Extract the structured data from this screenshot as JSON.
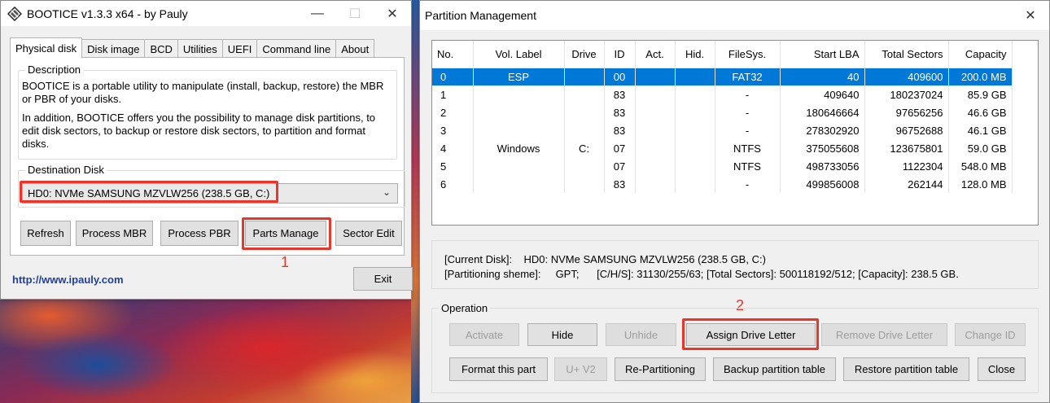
{
  "bootice": {
    "title": "BOOTICE v1.3.3 x64 - by Pauly",
    "tabs": [
      "Physical disk",
      "Disk image",
      "BCD",
      "Utilities",
      "UEFI",
      "Command line",
      "About"
    ],
    "description_legend": "Description",
    "description_p1": "BOOTICE is a portable utility to manipulate (install, backup, restore) the MBR or PBR of your disks.",
    "description_p2": "In addition, BOOTICE offers you the possibility to manage disk partitions, to edit disk sectors, to backup or restore disk sectors, to partition and format disks.",
    "destination_legend": "Destination Disk",
    "destination_value": "HD0: NVMe SAMSUNG MZVLW256 (238.5 GB, C:)",
    "buttons": {
      "refresh": "Refresh",
      "process_mbr": "Process MBR",
      "process_pbr": "Process PBR",
      "parts_manage": "Parts Manage",
      "sector_edit": "Sector Edit",
      "exit": "Exit"
    },
    "link": "http://www.ipauly.com",
    "step1": "1"
  },
  "partmgr": {
    "title": "Partition Management",
    "columns": [
      "No.",
      "Vol. Label",
      "Drive",
      "ID",
      "Act.",
      "Hid.",
      "FileSys.",
      "Start LBA",
      "Total Sectors",
      "Capacity"
    ],
    "rows": [
      [
        "0",
        "ESP",
        "",
        "00",
        "",
        "",
        "FAT32",
        "40",
        "409600",
        "200.0 MB"
      ],
      [
        "1",
        "",
        "",
        "83",
        "",
        "",
        "-",
        "409640",
        "180237024",
        "85.9 GB"
      ],
      [
        "2",
        "",
        "",
        "83",
        "",
        "",
        "-",
        "180646664",
        "97656256",
        "46.6 GB"
      ],
      [
        "3",
        "",
        "",
        "83",
        "",
        "",
        "-",
        "278302920",
        "96752688",
        "46.1 GB"
      ],
      [
        "4",
        "Windows",
        "C:",
        "07",
        "",
        "",
        "NTFS",
        "375055608",
        "123675801",
        "59.0 GB"
      ],
      [
        "5",
        "",
        "",
        "07",
        "",
        "",
        "NTFS",
        "498733056",
        "1122304",
        "548.0 MB"
      ],
      [
        "6",
        "",
        "",
        "83",
        "",
        "",
        "-",
        "499856008",
        "262144",
        "128.0 MB"
      ]
    ],
    "selected_row": 0,
    "info_line1": "[Current Disk]:    HD0: NVMe SAMSUNG MZVLW256 (238.5 GB, C:)",
    "info_line2": "[Partitioning sheme]:     GPT;      [C/H/S]: 31130/255/63; [Total Sectors]: 500118192/512; [Capacity]: 238.5 GB.",
    "operation_legend": "Operation",
    "buttons": {
      "activate": "Activate",
      "hide": "Hide",
      "unhide": "Unhide",
      "assign": "Assign Drive Letter",
      "remove": "Remove Drive Letter",
      "change_id": "Change ID",
      "format": "Format this part",
      "uv2": "U+ V2",
      "repartition": "Re-Partitioning",
      "backup": "Backup partition table",
      "restore": "Restore partition table",
      "close": "Close"
    },
    "step2": "2"
  },
  "colors": {
    "highlight": "#e8362a",
    "selection": "#0078d7",
    "link": "#1f3f9e"
  }
}
